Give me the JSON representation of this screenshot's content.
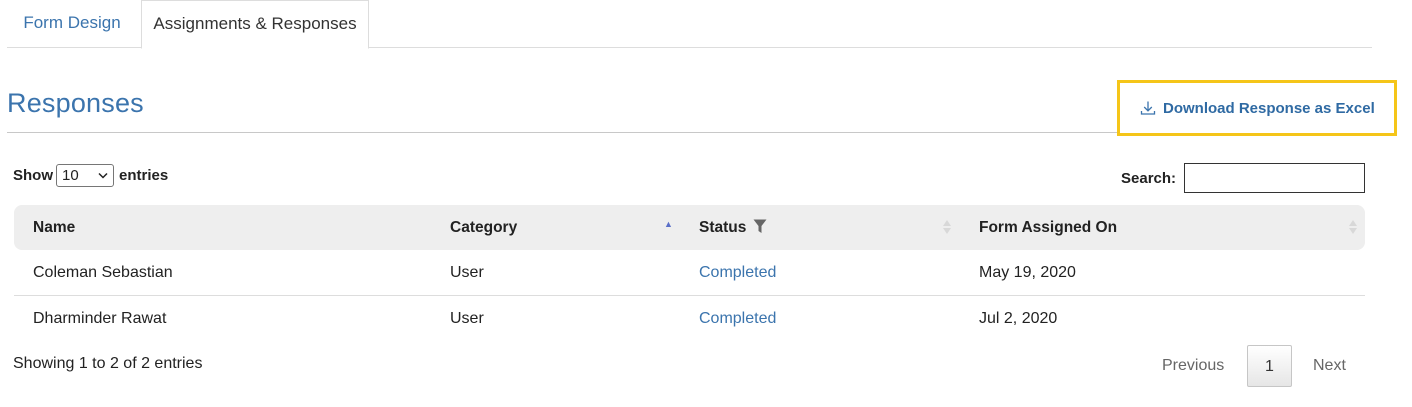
{
  "tabs": {
    "design": "Form Design",
    "responses": "Assignments & Responses"
  },
  "heading": "Responses",
  "download": {
    "label": "Download Response as Excel",
    "icon": "download-icon"
  },
  "length": {
    "show": "Show",
    "value": "10",
    "entries": "entries"
  },
  "search": {
    "label": "Search:",
    "value": ""
  },
  "table": {
    "columns": [
      "Name",
      "Category",
      "Status",
      "Form Assigned On"
    ],
    "sort": {
      "category": "ascending"
    },
    "rows": [
      {
        "name": "Coleman Sebastian",
        "category": "User",
        "status": "Completed",
        "assigned_on": "May 19, 2020"
      },
      {
        "name": "Dharminder Rawat",
        "category": "User",
        "status": "Completed",
        "assigned_on": "Jul 2, 2020"
      }
    ]
  },
  "footer": {
    "info": "Showing 1 to 2 of 2 entries",
    "previous": "Previous",
    "page": "1",
    "next": "Next"
  },
  "colors": {
    "link": "#3b74ad",
    "highlight": "#f5c518",
    "header_bg": "#eeeeee"
  }
}
